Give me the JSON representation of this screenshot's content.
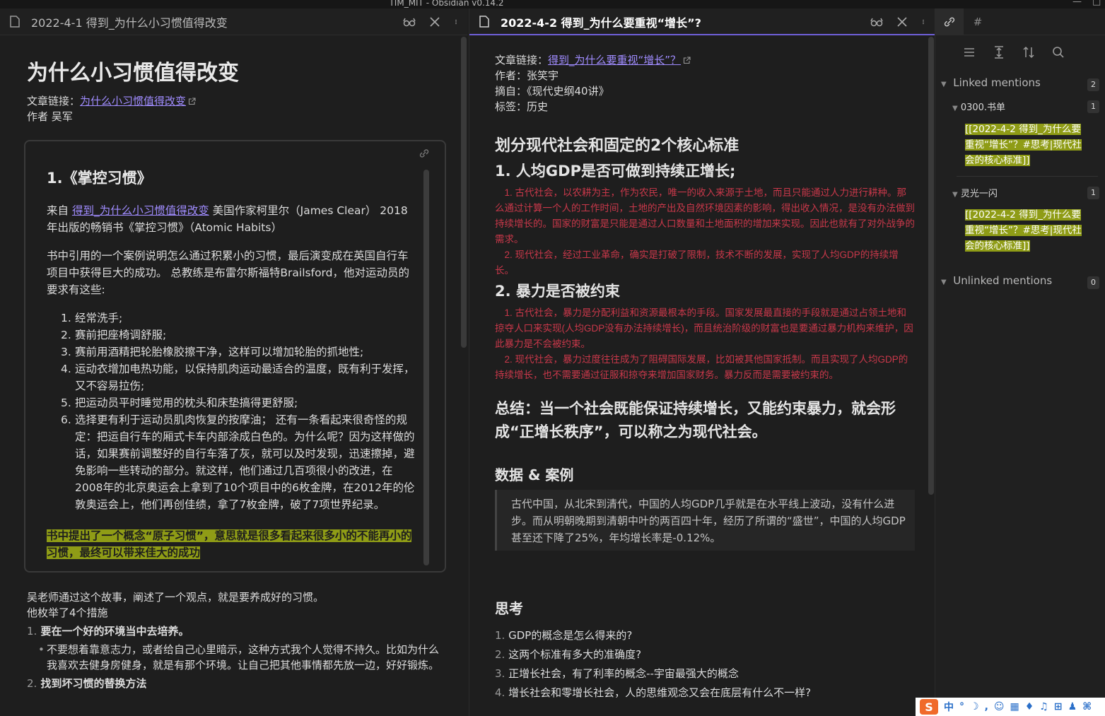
{
  "window": {
    "title": "TIM_MIT - Obsidian v0.14.2",
    "min": "—",
    "max": "□"
  },
  "left_pane": {
    "tab_title": "2022-4-1 得到_为什么小习惯值得改变",
    "h1": "为什么小习惯值得改变",
    "link_label": "文章链接：",
    "link_text": "为什么小习惯值得改变",
    "author": "作者 吴军",
    "embed": {
      "h2": "1.《掌控习惯》",
      "p1_prefix": "来自 ",
      "p1_link": "得到_为什么小习惯值得改变",
      "p1_rest": " 美国作家柯里尔（James Clear） 2018年出版的畅销书《掌控习惯》（Atomic Habits）",
      "p2": "书中引用的一个案例说明怎么通过积累小的习惯，最后演变成在英国自行车项目中获得巨大的成功。 总教练是布雷尔斯福特Brailsford，他对运动员的要求有这些:",
      "list": [
        {
          "n": "1.",
          "t": "经常洗手;"
        },
        {
          "n": "2.",
          "t": "赛前把座椅调舒服;"
        },
        {
          "n": "3.",
          "t": "赛前用酒精把轮胎橡胶擦干净，这样可以增加轮胎的抓地性;"
        },
        {
          "n": "4.",
          "t": "运动衣增加电热功能，以保持肌肉运动最适合的温度，既有利于发挥，又不容易拉伤;"
        },
        {
          "n": "5.",
          "t": "把运动员平时睡觉用的枕头和床垫搞得更舒服;"
        },
        {
          "n": "6.",
          "t": "选择更有利于运动员肌肉恢复的按摩油； 还有一条看起来很奇怪的规定：把运自行车的厢式卡车内部涂成白色的。为什么呢？因为这样做的话，如果赛前调整好的自行车落了灰，就可以及时发现，迅速擦掉，避免影响一些转动的部分。就这样，他们通过几百项很小的改进，在2008年的北京奥运会上拿到了10个项目中的6枚金牌，在2012年的伦敦奥运会上，他们再创佳绩，拿了7枚金牌，破了7项世界纪录。"
        }
      ],
      "highlight": "书中提出了一个概念“原子习惯”，意思就是很多看起来很多小的不能再小的习惯，最终可以带来佳大的成功"
    },
    "after1": "吴老师通过这个故事，阐述了一个观点，就是要养成好的习惯。",
    "after2": "他枚举了4个措施",
    "m1_n": "1.",
    "m1": "要在一个好的环境当中去培养。",
    "m1_sub": "不要想着靠意志力，或者给自己心里暗示，这种方式我个人觉得不持久。比如为什么我喜欢去健身房健身，就是有那个环境。让自己把其他事情都先放一边，好好锻炼。",
    "m2_n": "2.",
    "m2": "找到坏习惯的替换方法"
  },
  "right_pane": {
    "tab_title": "2022-4-2 得到_为什么要重视“增长”?",
    "link_label": "文章链接：",
    "link_text": "得到_为什么要重视“增长”？",
    "author": "作者：张笑宇",
    "source": "摘自：《现代史纲40讲》",
    "tags": "标签：历史",
    "h2": "划分现代社会和固定的2个核心标准",
    "s1": "1. 人均GDP是否可做到持续正增长;",
    "s1_p1": "　1. 古代社会，以农耕为主，作为农民，唯一的收入来源于土地，而且只能通过人力进行耕种。那么通过计算一个人的工作时间，土地的产出及自然环境因素的影响，得出收入情况，是没有办法做到持续增长的。国家的财富是只能是通过人口数量和土地面积的增加来实现。因此也就有了对外战争的需求。",
    "s1_p2": "　2. 现代社会，经过工业革命，确实是打破了限制，技术不断的发展，实现了人均GDP的持续增长。",
    "s2": "2. 暴力是否被约束",
    "s2_p1": "　1. 古代社会，暴力是分配利益和资源最根本的手段。国家发展最直接的手段就是通过占领土地和掠夺人口来实现(人均GDP没有办法持续增长)，而且统治阶级的财富也是要通过暴力机构来维护，因此暴力是不会被约束。",
    "s2_p2": "　2. 现代社会，暴力过度往往成为了阻碍国际发展，比如被其他国家抵制。而且实现了人均GDP的持续增长，也不需要通过征服和掠夺来增加国家财务。暴力反而是需要被约束的。",
    "summary": "总结：当一个社会既能保证持续增长，又能约束暴力，就会形成“正增长秩序”，可以称之为现代社会。",
    "data_h": "数据 & 案例",
    "quote": "古代中国，从北宋到清代，中国的人均GDP几乎就是在水平线上波动，没有什么进步。而从明朝晚期到清朝中叶的两百四十年，经历了所谓的“盛世”，中国的人均GDP甚至还下降了25%，年均增长率是-0.12%。",
    "think_h": "思考",
    "questions": [
      {
        "n": "1.",
        "t": "GDP的概念是怎么得来的?"
      },
      {
        "n": "2.",
        "t": "这两个标准有多大的准确度?"
      },
      {
        "n": "3.",
        "t": "正增长社会，有了利率的概念--宇宙最强大的概念"
      },
      {
        "n": "4.",
        "t": "增长社会和零增长社会，人的思维观念又会在底层有什么不一样?"
      }
    ]
  },
  "sidebar": {
    "tab_hash": "#",
    "linked_label": "Linked mentions",
    "linked_count": "2",
    "files": [
      {
        "name": "0300.书单",
        "count": "1",
        "snippet": "[[2022-4-2 得到_为什么要重视“增长”？#思考|现代社会的核心标准]]"
      },
      {
        "name": "灵光一闪",
        "count": "1",
        "snippet": "[[2022-4-2 得到_为什么要重视“增长”？#思考|现代社会的核心标准]]"
      }
    ],
    "unlinked_label": "Unlinked mentions",
    "unlinked_count": "0"
  },
  "tray": {
    "ime": "S",
    "items": [
      "中",
      "°",
      "☽",
      ",",
      "☺",
      "▦",
      "♦",
      "♫",
      "⊞",
      "♟",
      "⌘"
    ]
  }
}
